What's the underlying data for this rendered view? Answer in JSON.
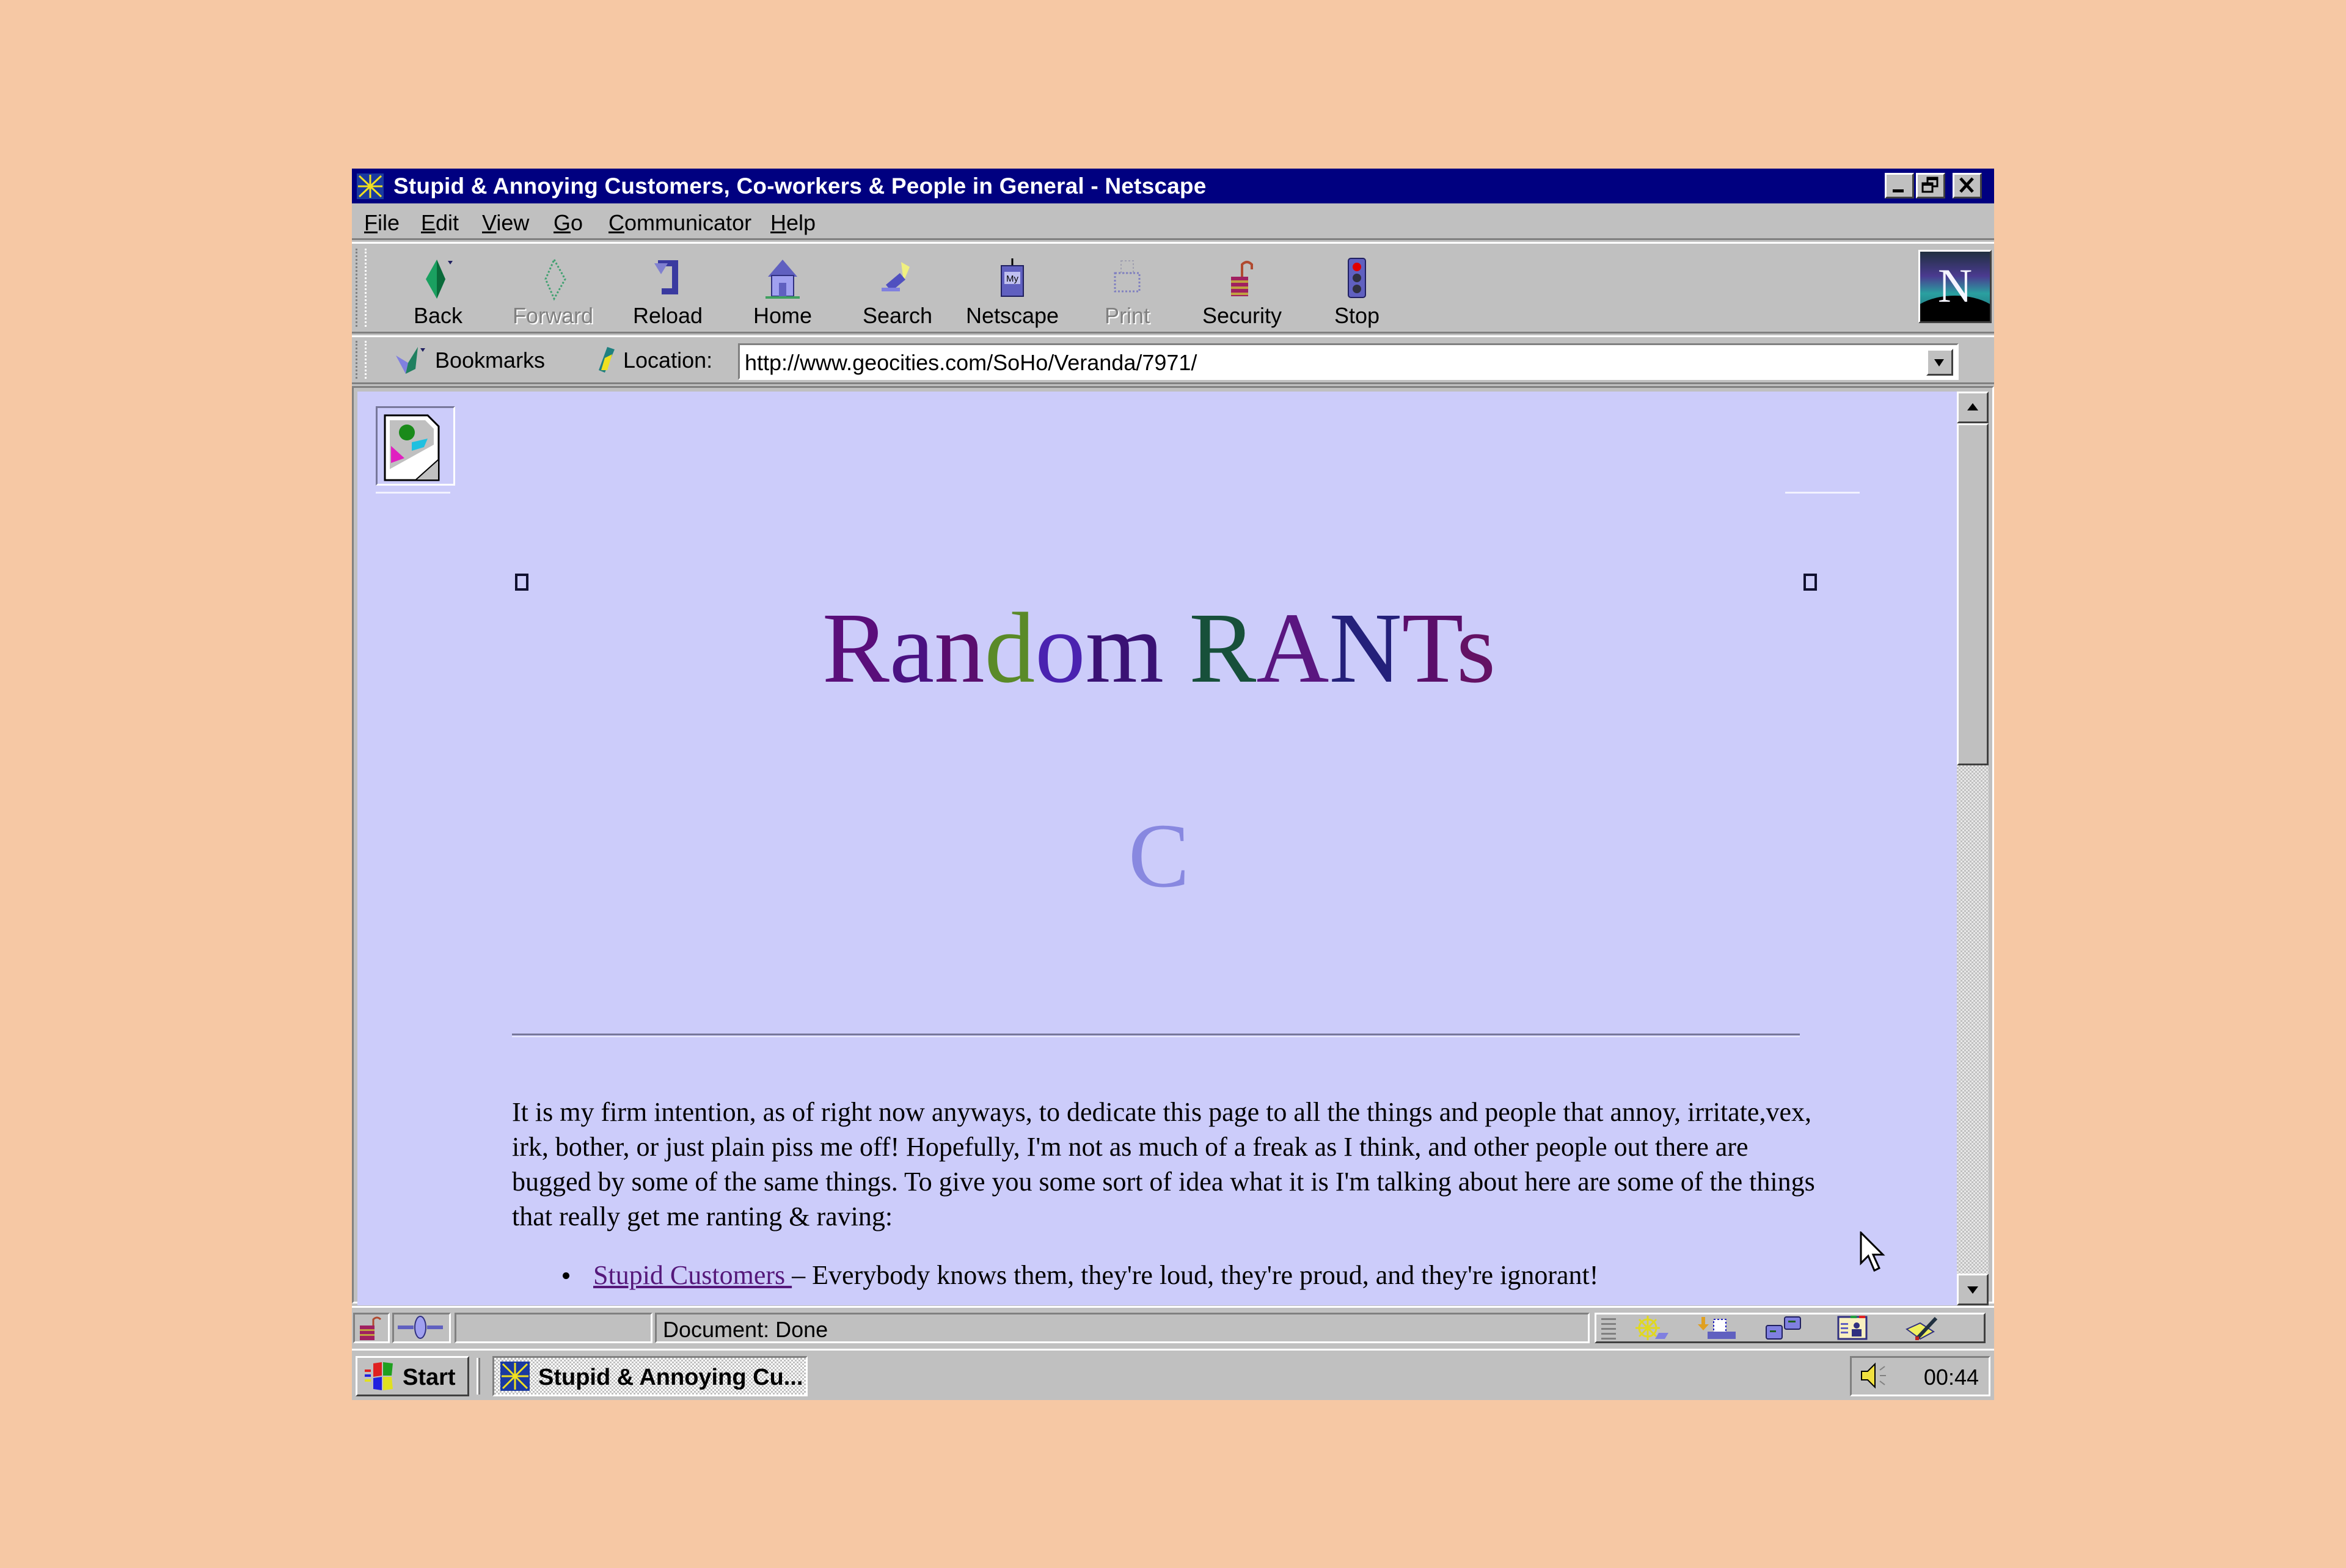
{
  "window": {
    "title": "Stupid & Annoying Customers, Co-workers & People in General - Netscape",
    "controls": {
      "minimize": "minimize",
      "restore": "restore",
      "close": "close"
    }
  },
  "menubar": {
    "items": [
      {
        "label": "File",
        "accel": "F"
      },
      {
        "label": "Edit",
        "accel": "E"
      },
      {
        "label": "View",
        "accel": "V"
      },
      {
        "label": "Go",
        "accel": "G"
      },
      {
        "label": "Communicator",
        "accel": "C"
      },
      {
        "label": "Help",
        "accel": "H"
      }
    ]
  },
  "toolbar": {
    "buttons": [
      {
        "label": "Back",
        "icon": "back-arrow-icon",
        "enabled": true
      },
      {
        "label": "Forward",
        "icon": "forward-arrow-icon",
        "enabled": false
      },
      {
        "label": "Reload",
        "icon": "reload-icon",
        "enabled": true
      },
      {
        "label": "Home",
        "icon": "home-icon",
        "enabled": true
      },
      {
        "label": "Search",
        "icon": "search-flashlight-icon",
        "enabled": true
      },
      {
        "label": "Netscape",
        "icon": "my-netscape-icon",
        "enabled": true
      },
      {
        "label": "Print",
        "icon": "printer-icon",
        "enabled": false
      },
      {
        "label": "Security",
        "icon": "padlock-open-icon",
        "enabled": true
      },
      {
        "label": "Stop",
        "icon": "stop-traffic-light-icon",
        "enabled": true
      }
    ]
  },
  "location_bar": {
    "bookmarks_label": "Bookmarks",
    "location_label": "Location:",
    "url": "http://www.geocities.com/SoHo/Veranda/7971/"
  },
  "page": {
    "heading_letters": [
      {
        "ch": "R",
        "color": "#5a0e7a"
      },
      {
        "ch": "a",
        "color": "#4a1282"
      },
      {
        "ch": "n",
        "color": "#5a0e6e"
      },
      {
        "ch": "d",
        "color": "#5a8a28"
      },
      {
        "ch": "o",
        "color": "#4a22b0"
      },
      {
        "ch": "m",
        "color": "#3a1274"
      },
      {
        "ch": " ",
        "color": "#000000"
      },
      {
        "ch": "R",
        "color": "#17503a"
      },
      {
        "ch": "A",
        "color": "#5a1680"
      },
      {
        "ch": "N",
        "color": "#24207a"
      },
      {
        "ch": "T",
        "color": "#5a0e6a"
      },
      {
        "ch": "s",
        "color": "#641264"
      }
    ],
    "drop_cap": "C",
    "intro_paragraph": "It is my firm intention, as of right now anyways, to dedicate this page to all the things and people that annoy, irritate,vex, irk, bother, or just plain piss me off! Hopefully, I'm not as much of a freak as I think, and other people out there are bugged by some of the same things. To give you some sort of idea what it is I'm talking about here are some of the things that really get me ranting & raving:",
    "list": [
      {
        "link": "Stupid Customers ",
        "text": "– Everybody knows them, they're loud, they're proud, and they're ignorant!"
      }
    ]
  },
  "statusbar": {
    "status_text": "Document: Done",
    "component_icons": [
      "navigator-icon",
      "inbox-icon",
      "discussions-icon",
      "address-book-icon",
      "composer-icon"
    ]
  },
  "taskbar": {
    "start_label": "Start",
    "task_label": "Stupid & Annoying Cu...",
    "clock": "00:44"
  },
  "colors": {
    "desktop": "#f6c8a4",
    "titlebar": "#000080",
    "page_background": "#ccccfa",
    "link": "#55187a",
    "dropcap": "#8888e0"
  }
}
